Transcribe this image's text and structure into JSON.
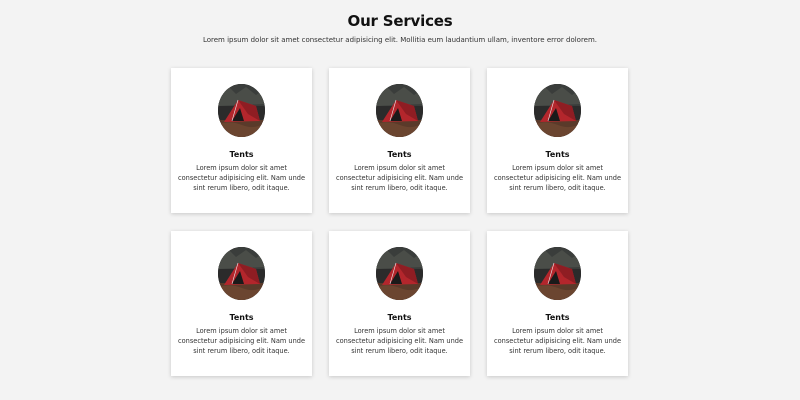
{
  "header": {
    "title": "Our Services",
    "subtitle": "Lorem ipsum dolor sit amet consectetur adipisicing elit. Mollitia eum laudantium ullam, inventore error dolorem."
  },
  "cards": [
    {
      "icon": "tent-photo",
      "title": "Tents",
      "text": "Lorem ipsum dolor sit amet consectetur adipisicing elit. Nam unde sint rerum libero, odit itaque."
    },
    {
      "icon": "tent-photo",
      "title": "Tents",
      "text": "Lorem ipsum dolor sit amet consectetur adipisicing elit. Nam unde sint rerum libero, odit itaque."
    },
    {
      "icon": "tent-photo",
      "title": "Tents",
      "text": "Lorem ipsum dolor sit amet consectetur adipisicing elit. Nam unde sint rerum libero, odit itaque."
    },
    {
      "icon": "tent-photo",
      "title": "Tents",
      "text": "Lorem ipsum dolor sit amet consectetur adipisicing elit. Nam unde sint rerum libero, odit itaque."
    },
    {
      "icon": "tent-photo",
      "title": "Tents",
      "text": "Lorem ipsum dolor sit amet consectetur adipisicing elit. Nam unde sint rerum libero, odit itaque."
    },
    {
      "icon": "tent-photo",
      "title": "Tents",
      "text": "Lorem ipsum dolor sit amet consectetur adipisicing elit. Nam unde sint rerum libero, odit itaque."
    }
  ],
  "colors": {
    "background": "#f3f3f3",
    "card": "#ffffff",
    "tent_red": "#b3262c"
  }
}
